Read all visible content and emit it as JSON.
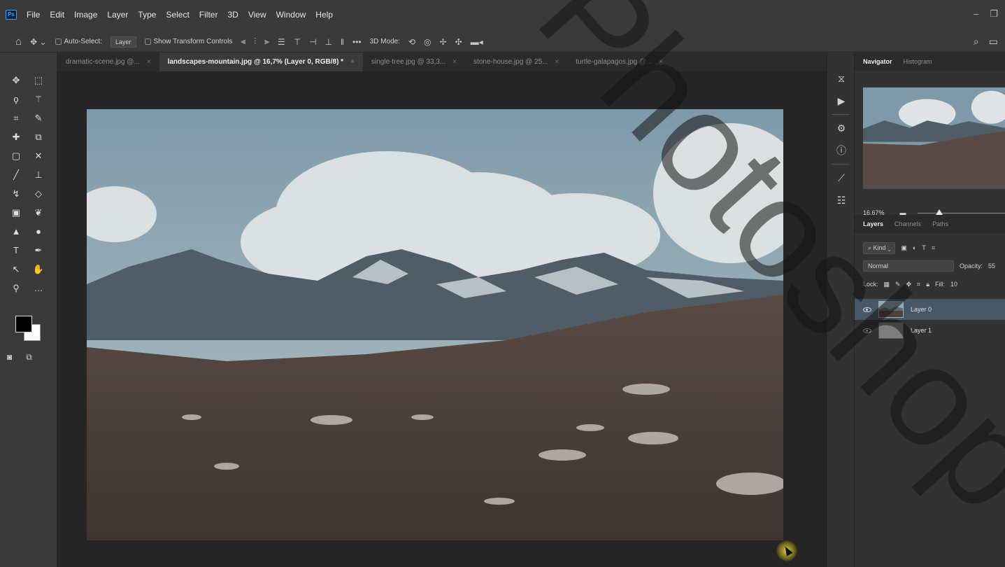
{
  "app": {
    "logo": "Ps",
    "menus": [
      "File",
      "Edit",
      "Image",
      "Layer",
      "Type",
      "Select",
      "Filter",
      "3D",
      "View",
      "Window",
      "Help"
    ]
  },
  "options_bar": {
    "auto_select_label": "Auto-Select:",
    "auto_select_value": "Layer",
    "show_transform_label": "Show Transform Controls",
    "mode_3d_label": "3D Mode:"
  },
  "tabs": [
    {
      "label": "dramatic-scene.jpg @...",
      "active": false
    },
    {
      "label": "landscapes-mountain.jpg @ 16,7% (Layer 0, RGB/8) *",
      "active": true
    },
    {
      "label": "single-tree.jpg @ 33,3...",
      "active": false
    },
    {
      "label": "stone-house.jpg @ 25...",
      "active": false
    },
    {
      "label": "turtle-galapagos.jpg @...",
      "active": false
    }
  ],
  "navigator": {
    "tabs": [
      "Navigator",
      "Histogram"
    ],
    "zoom": "16,67%",
    "zoom_slider_fraction": 0.25
  },
  "layers": {
    "tabs": [
      "Layers",
      "Channels",
      "Paths"
    ],
    "filter_label": "Kind",
    "blend_mode": "Normal",
    "opacity_label": "Opacity:",
    "opacity_value": "55",
    "lock_label": "Lock:",
    "fill_label": "Fill:",
    "fill_value": "10",
    "items": [
      {
        "name": "Layer 0",
        "selected": true
      },
      {
        "name": "Layer 1",
        "selected": false
      }
    ]
  },
  "watermark_text": "Photoshop",
  "colors": {
    "foreground": "#000000",
    "background": "#ffffff",
    "accent": "#31a8ff"
  }
}
